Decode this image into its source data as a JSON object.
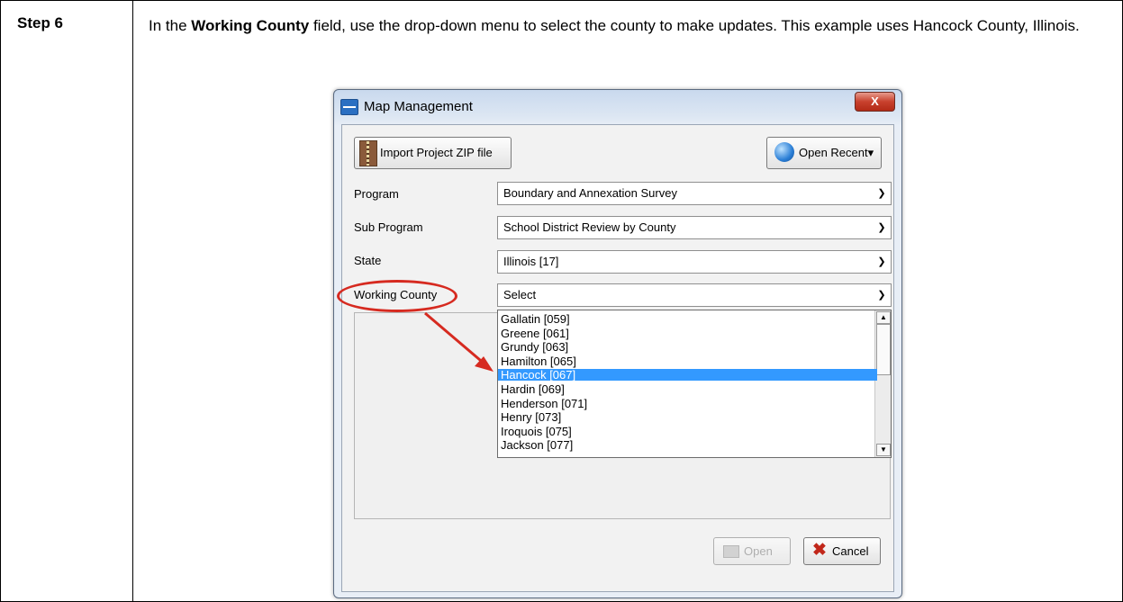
{
  "step": {
    "label": "Step 6"
  },
  "instruction": {
    "prefix": "In the ",
    "bold": "Working County",
    "suffix": " field, use the drop-down menu to select the county to make updates. This example uses Hancock County, Illinois."
  },
  "dialog": {
    "title": "Map Management",
    "close_label": "X",
    "import_button": "Import Project ZIP file",
    "open_recent_button": "Open Recent▾",
    "fields": {
      "program": {
        "label": "Program",
        "value": "Boundary and Annexation Survey"
      },
      "sub_program": {
        "label": "Sub Program",
        "value": "School District Review by County"
      },
      "state": {
        "label": "State",
        "value": "Illinois [17]"
      },
      "working_county": {
        "label": "Working County",
        "value": "Select"
      }
    },
    "dropdown_items": [
      "Gallatin [059]",
      "Greene [061]",
      "Grundy [063]",
      "Hamilton [065]",
      "Hancock [067]",
      "Hardin [069]",
      "Henderson [071]",
      "Henry [073]",
      "Iroquois [075]",
      "Jackson [077]"
    ],
    "selected_item": "Hancock [067]",
    "open_button": "Open",
    "cancel_button": "Cancel"
  },
  "colors": {
    "annotation": "#d62a20",
    "selection": "#3399ff"
  }
}
